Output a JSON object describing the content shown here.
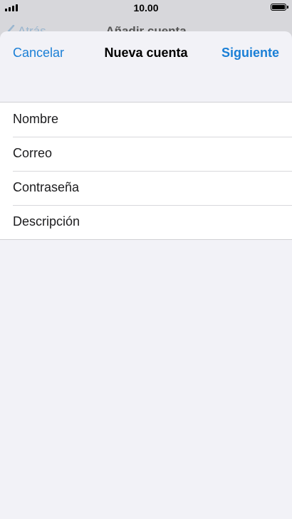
{
  "status_bar": {
    "time": "10.00"
  },
  "background_screen": {
    "back_label": "Atrás",
    "title": "Añadir cuenta"
  },
  "nav": {
    "cancel_label": "Cancelar",
    "title": "Nueva cuenta",
    "next_label": "Siguiente"
  },
  "form": {
    "fields": [
      {
        "placeholder": "Nombre",
        "value": ""
      },
      {
        "placeholder": "Correo",
        "value": ""
      },
      {
        "placeholder": "Contraseña",
        "value": ""
      },
      {
        "placeholder": "Descripción",
        "value": ""
      }
    ]
  },
  "colors": {
    "accent": "#1a7fd6",
    "sheet_background": "#f2f2f7"
  },
  "icons": {
    "signal": "cellular-signal-icon",
    "battery": "battery-icon",
    "back": "chevron-left-icon"
  }
}
